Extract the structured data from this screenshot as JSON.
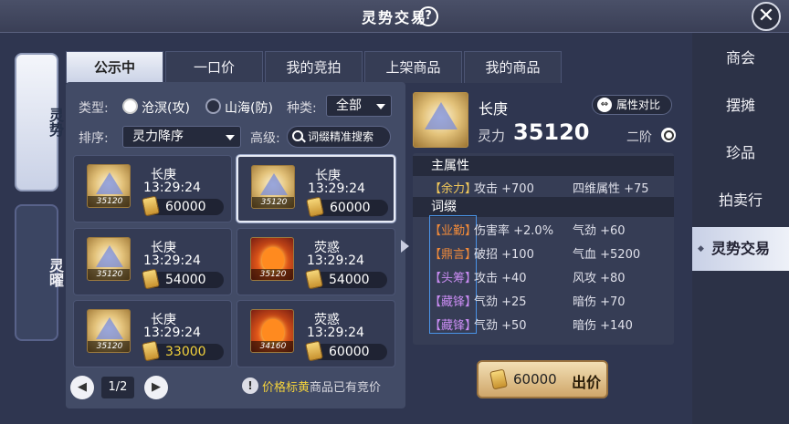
{
  "window": {
    "title": "灵势交易"
  },
  "right_nav": [
    "商会",
    "摆摊",
    "珍品",
    "拍卖行",
    "灵势交易"
  ],
  "left_tabs": [
    "灵势",
    "灵曜"
  ],
  "tabs": [
    "公示中",
    "一口价",
    "我的竞拍",
    "上架商品",
    "我的商品"
  ],
  "filters": {
    "type_label": "类型:",
    "type_opt1": "沧溟(攻)",
    "type_opt2": "山海(防)",
    "kind_label": "种类:",
    "kind_value": "全部",
    "sort_label": "排序:",
    "sort_value": "灵力降序",
    "advanced_label": "高级:",
    "search_button": "词缀精准搜索"
  },
  "items": [
    {
      "name": "长庚",
      "time": "13:29:24",
      "power": "35120",
      "price": "60000",
      "icon": "gold",
      "price_color": "white"
    },
    {
      "name": "长庚",
      "time": "13:29:24",
      "power": "35120",
      "price": "60000",
      "icon": "gold",
      "price_color": "white"
    },
    {
      "name": "长庚",
      "time": "13:29:24",
      "power": "35120",
      "price": "54000",
      "icon": "gold",
      "price_color": "white"
    },
    {
      "name": "荧惑",
      "time": "13:29:24",
      "power": "35120",
      "price": "54000",
      "icon": "fire",
      "price_color": "white"
    },
    {
      "name": "长庚",
      "time": "13:29:24",
      "power": "35120",
      "price": "33000",
      "icon": "gold",
      "price_color": "yellow"
    },
    {
      "name": "荧惑",
      "time": "13:29:24",
      "power": "34160",
      "price": "60000",
      "icon": "fire",
      "price_color": "white"
    }
  ],
  "pager": {
    "text": "1/2"
  },
  "notice": {
    "pre": "价格标黄",
    "post": "商品已有竞价"
  },
  "detail": {
    "name": "长庚",
    "power_label": "灵力",
    "power": "35120",
    "rank": "二阶",
    "compare_button": "属性对比",
    "main_attr_title": "主属性",
    "main_attr": {
      "tag": "【余力】",
      "stat1": "攻击 +700",
      "stat2": "四维属性 +75"
    },
    "affix_title": "词缀",
    "affixes": [
      {
        "tag": "【业勤】",
        "color": "orange",
        "stat1": "伤害率 +2.0%",
        "stat2": "气劲 +60"
      },
      {
        "tag": "【鼎言】",
        "color": "orange",
        "stat1": "破招 +100",
        "stat2": "气血 +5200"
      },
      {
        "tag": "【头筹】",
        "color": "purple",
        "stat1": "攻击 +40",
        "stat2": "风攻 +80"
      },
      {
        "tag": "【藏锋】",
        "color": "purple",
        "stat1": "气劲 +25",
        "stat2": "暗伤 +70"
      },
      {
        "tag": "【藏锋】",
        "color": "purple",
        "stat1": "气劲 +50",
        "stat2": "暗伤 +140"
      }
    ]
  },
  "bid": {
    "price": "60000",
    "label": "出价"
  },
  "colors": {
    "accent_yellow": "#f3d23c",
    "panel": "#424b66",
    "background": "#2f3650"
  }
}
